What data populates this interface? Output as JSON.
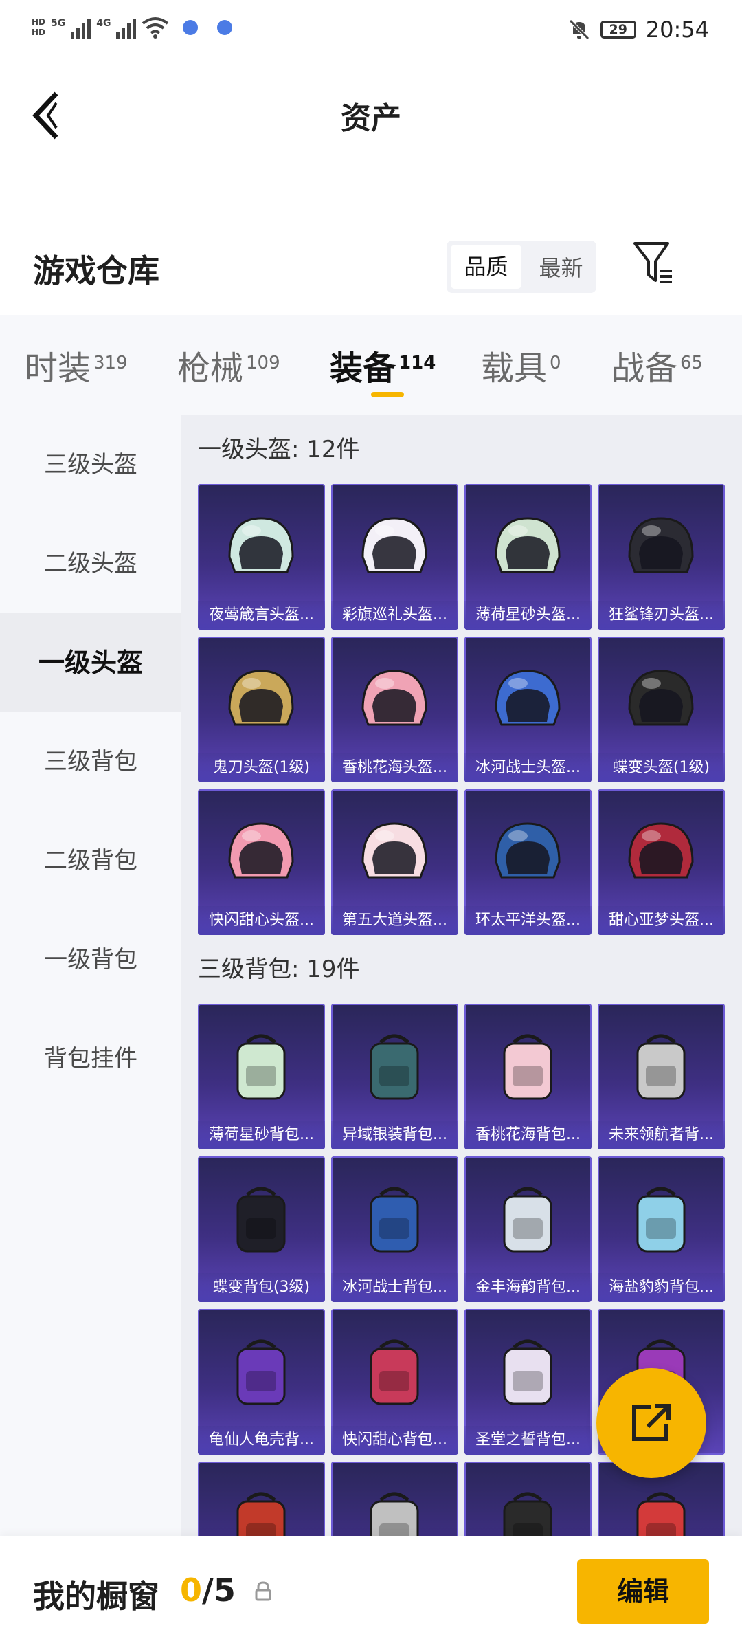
{
  "status_bar": {
    "net1": "5G",
    "net2": "4G",
    "battery": "29",
    "time": "20:54"
  },
  "header": {
    "title": "资产"
  },
  "warehouse": {
    "title": "游戏仓库",
    "sort_options": [
      "品质",
      "最新"
    ],
    "sort_selected": "品质"
  },
  "tabs": [
    {
      "label": "时装",
      "count": "319"
    },
    {
      "label": "枪械",
      "count": "109"
    },
    {
      "label": "装备",
      "count": "114"
    },
    {
      "label": "载具",
      "count": "0"
    },
    {
      "label": "战备",
      "count": "65"
    }
  ],
  "active_tab": "装备",
  "sidebar": {
    "items": [
      "三级头盔",
      "二级头盔",
      "一级头盔",
      "三级背包",
      "二级背包",
      "一级背包",
      "背包挂件"
    ],
    "active": "一级头盔"
  },
  "groups": [
    {
      "title": "一级头盔: 12件",
      "items": [
        "夜莺箴言头盔...",
        "彩旗巡礼头盔...",
        "薄荷星砂头盔...",
        "狂鲨锋刃头盔...",
        "鬼刀头盔(1级)",
        "香桃花海头盔...",
        "冰河战士头盔...",
        "蝶变头盔(1级)",
        "快闪甜心头盔...",
        "第五大道头盔...",
        "环太平洋头盔...",
        "甜心亚梦头盔..."
      ]
    },
    {
      "title": "三级背包: 19件",
      "items": [
        "薄荷星砂背包...",
        "异域银装背包...",
        "香桃花海背包...",
        "未来领航者背...",
        "蝶变背包(3级)",
        "冰河战士背包...",
        "金丰海韵背包...",
        "海盐豹豹背包...",
        "龟仙人龟壳背...",
        "快闪甜心背包...",
        "圣堂之誓背包...",
        "",
        "",
        "",
        "",
        ""
      ]
    }
  ],
  "bottom_bar": {
    "title": "我的橱窗",
    "count_current": "0",
    "count_total": "/5",
    "edit_label": "编辑"
  },
  "colors": {
    "accent": "#f7b500",
    "card_bg": "#3e2f82",
    "card_border": "#6d5bd6"
  }
}
